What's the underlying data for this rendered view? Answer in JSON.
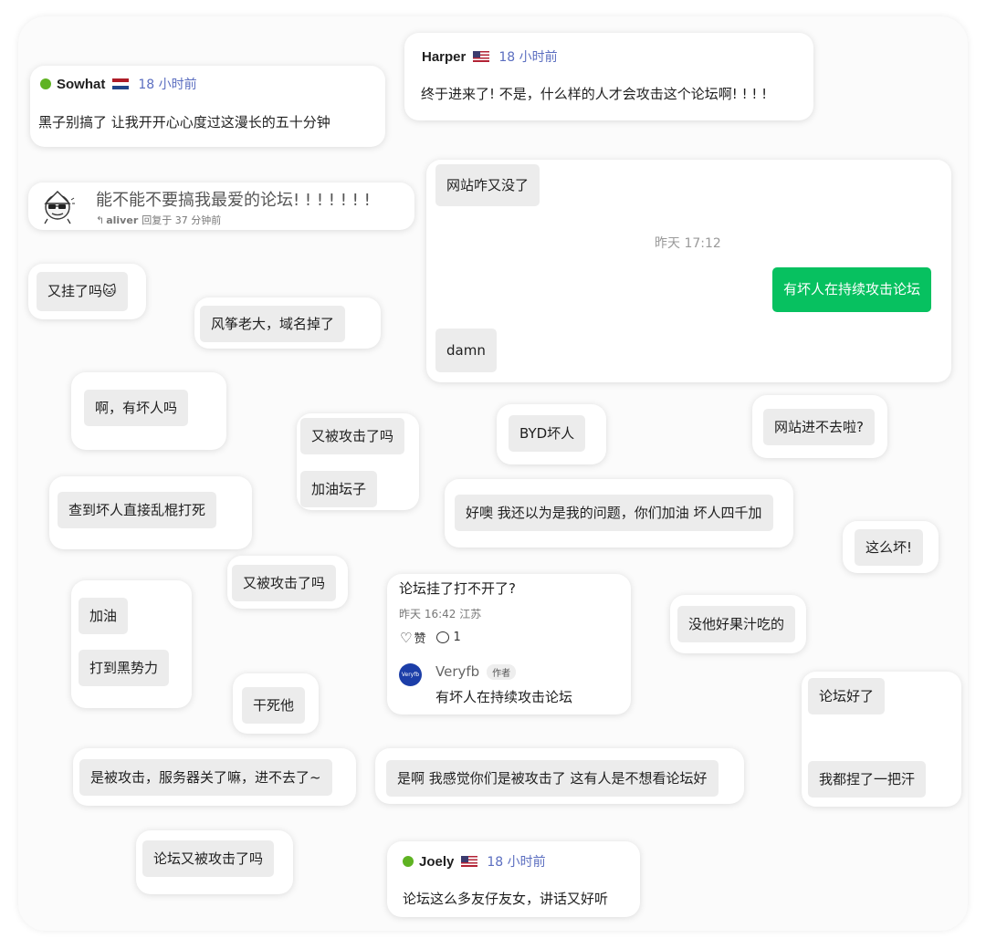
{
  "sowhat": {
    "name": "Sowhat",
    "time": "18 小时前",
    "text": "黑子别搞了 让我开开心心度过这漫长的五十分钟"
  },
  "harper": {
    "name": "Harper",
    "time": "18 小时前",
    "text": "终于进来了! 不是，什么样的人才会攻击这个论坛啊! ! ! !"
  },
  "aliver": {
    "text": "能不能不要搞我最爱的论坛! ! ! ! ! ! !",
    "author": "aliver",
    "meta": "回复于 37 分钟前"
  },
  "wechat": {
    "msg1": "网站咋又没了",
    "time": "昨天 17:12",
    "msg2": "有坏人在持续攻击论坛",
    "msg3": "damn"
  },
  "bubbles": {
    "guale": "又挂了吗🐱",
    "fengzheng": "风筝老大，域名掉了",
    "a_huairen": "啊，有坏人吗",
    "beigongji": "又被攻击了吗",
    "jiayou_tanzi": "加油坛子",
    "byd": "BYD坏人",
    "jinbuqu": "网站进不去啦?",
    "chadao": "查到坏人直接乱棍打死",
    "haoyi": "好噢 我还以为是我的问题，你们加油 坏人四千加",
    "zhemehuai": "这么坏!",
    "beigongji2": "又被攻击了吗",
    "jiayou": "加油",
    "heishili": "打到黑势力",
    "gansita": "干死他",
    "meita": "没他好果汁吃的",
    "luntanhaole": "论坛好了",
    "niehan": "我都捏了一把汗",
    "shibei": "是被攻击，服务器关了嘛，进不去了~",
    "shia": "是啊 我感觉你们是被攻击了 这有人是不想看论坛好",
    "youbei": "论坛又被攻击了吗"
  },
  "weibo": {
    "title": "论坛挂了打不开了?",
    "meta": "昨天 16:42 江苏",
    "like": "赞",
    "comments": "1",
    "author": "Veryfb",
    "author_tag": "作者",
    "avatar_text": "Veryfb",
    "reply": "有坏人在持续攻击论坛"
  },
  "joely": {
    "name": "Joely",
    "time": "18 小时前",
    "text": "论坛这么多友仔友女，讲话又好听"
  },
  "colors": {
    "wechat_green": "#07c160",
    "online_dot": "#5fb322",
    "time_blue": "#5b6ec0",
    "veryfb_blue": "#1c3ea8"
  }
}
